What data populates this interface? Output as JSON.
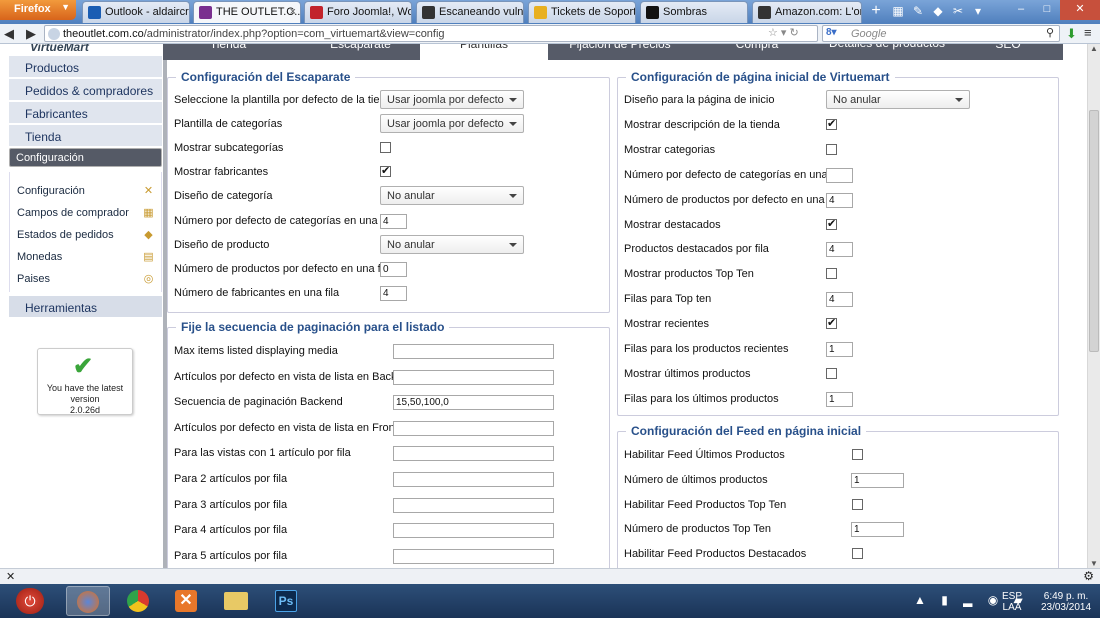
{
  "browser": {
    "ff_label": "Firefox",
    "tabs": [
      {
        "label": "Outlook - aldaircre...",
        "color": "#1a5db3"
      },
      {
        "label": "THE OUTLET.C...",
        "color": "#7a2f8f"
      },
      {
        "label": "Foro Joomla!, Word...",
        "color": "#c2232b"
      },
      {
        "label": "Escaneando vulner...",
        "color": "#333333"
      },
      {
        "label": "Tickets de Soporte ...",
        "color": "#e8b020"
      },
      {
        "label": "Sombras",
        "color": "#111111"
      },
      {
        "label": "Amazon.com: L'ore...",
        "color": "#333333"
      }
    ],
    "url_host": "theoutlet.com.co",
    "url_path": "/administrator/index.php?option=com_virtuemart&view=config",
    "search_placeholder": "Google",
    "win_min": "–",
    "win_max": "□",
    "win_close": "✕"
  },
  "sidebar": {
    "logo": "VirtueMart",
    "menu": [
      "Productos",
      "Pedidos & compradores",
      "Fabricantes",
      "Tienda",
      "Configuración"
    ],
    "submenu": [
      "Configuración",
      "Campos de comprador",
      "Estados de pedidos",
      "Monedas",
      "Paises"
    ],
    "tools": "Herramientas",
    "version_line1": "You have the latest",
    "version_line2": "version",
    "version_number": "2.0.26d"
  },
  "top_tabs": [
    "Tienda",
    "Escaparate",
    "Plantillas",
    "Fijación de Precios",
    "Compra",
    "Detalles de productos",
    "SEO"
  ],
  "escaparate": {
    "legend": "Configuración del Escaparate",
    "rows": [
      {
        "label": "Seleccione la plantilla por defecto de la tienda",
        "type": "select",
        "value": "Usar joomla por defecto"
      },
      {
        "label": "Plantilla de categorías",
        "type": "select",
        "value": "Usar joomla por defecto"
      },
      {
        "label": "Mostrar subcategorías",
        "type": "check",
        "checked": false
      },
      {
        "label": "Mostrar fabricantes",
        "type": "check",
        "checked": true
      },
      {
        "label": "Diseño de categoría",
        "type": "select",
        "value": "No anular"
      },
      {
        "label": "Número por defecto de categorías en una fila",
        "type": "input",
        "value": "4"
      },
      {
        "label": "Diseño de producto",
        "type": "select",
        "value": "No anular"
      },
      {
        "label": "Número de productos por defecto en una fila",
        "type": "input",
        "value": "0"
      },
      {
        "label": "Número de fabricantes en una fila",
        "type": "input",
        "value": "4"
      }
    ]
  },
  "paginacion": {
    "legend": "Fije la secuencia de paginación para el listado",
    "rows": [
      {
        "label": "Max items listed displaying media",
        "value": ""
      },
      {
        "label": "Artículos por defecto en vista de lista en Backend",
        "value": ""
      },
      {
        "label": "Secuencia de paginación Backend",
        "value": "15,50,100,0"
      },
      {
        "label": "Artículos por defecto en vista de lista en Frontend",
        "value": ""
      },
      {
        "label": "Para las vistas con 1 artículo por fila",
        "value": ""
      },
      {
        "label": "Para 2 artículos por fila",
        "value": ""
      },
      {
        "label": "Para 3 artículos por fila",
        "value": ""
      },
      {
        "label": "Para 4 artículos por fila",
        "value": ""
      },
      {
        "label": "Para 5 artículos por fila",
        "value": ""
      }
    ]
  },
  "inicio": {
    "legend": "Configuración de página inicial de Virtuemart",
    "rows": [
      {
        "label": "Diseño para la página de inicio",
        "type": "select",
        "value": "No anular"
      },
      {
        "label": "Mostrar descripción de la tienda",
        "type": "check",
        "checked": true
      },
      {
        "label": "Mostrar categorias",
        "type": "check",
        "checked": false
      },
      {
        "label": "Número por defecto de categorías en una fila",
        "type": "input",
        "value": ""
      },
      {
        "label": "Número de productos por defecto en una fila",
        "type": "input",
        "value": "4"
      },
      {
        "label": "Mostrar destacados",
        "type": "check",
        "checked": true
      },
      {
        "label": "Productos destacados por fila",
        "type": "input",
        "value": "4"
      },
      {
        "label": "Mostrar productos Top Ten",
        "type": "check",
        "checked": false
      },
      {
        "label": "Filas para Top ten",
        "type": "input",
        "value": "4"
      },
      {
        "label": "Mostrar recientes",
        "type": "check",
        "checked": true
      },
      {
        "label": "Filas para los productos recientes",
        "type": "input",
        "value": "1"
      },
      {
        "label": "Mostrar últimos productos",
        "type": "check",
        "checked": false
      },
      {
        "label": "Filas para los últimos productos",
        "type": "input",
        "value": "1"
      }
    ]
  },
  "feed": {
    "legend": "Configuración del Feed en página inicial",
    "rows": [
      {
        "label": "Habilitar Feed Últimos Productos",
        "type": "check",
        "checked": false
      },
      {
        "label": "Número de últimos productos",
        "type": "input",
        "value": "1"
      },
      {
        "label": "Habilitar Feed Productos Top Ten",
        "type": "check",
        "checked": false
      },
      {
        "label": "Número de productos Top Ten",
        "type": "input",
        "value": "1"
      },
      {
        "label": "Habilitar Feed Productos Destacados",
        "type": "check",
        "checked": false
      }
    ]
  },
  "taskbar": {
    "lang": "ESP",
    "lang2": "LAA",
    "time": "6:49 p. m.",
    "date": "23/03/2014",
    "apps": [
      "power-icon",
      "firefox-icon",
      "chrome-icon",
      "xampp-icon",
      "explorer-icon",
      "photoshop-icon"
    ]
  },
  "colors": {
    "accent": "#28508a",
    "sidebar_selected": "#555a66",
    "tab_strip": "#565b68"
  }
}
